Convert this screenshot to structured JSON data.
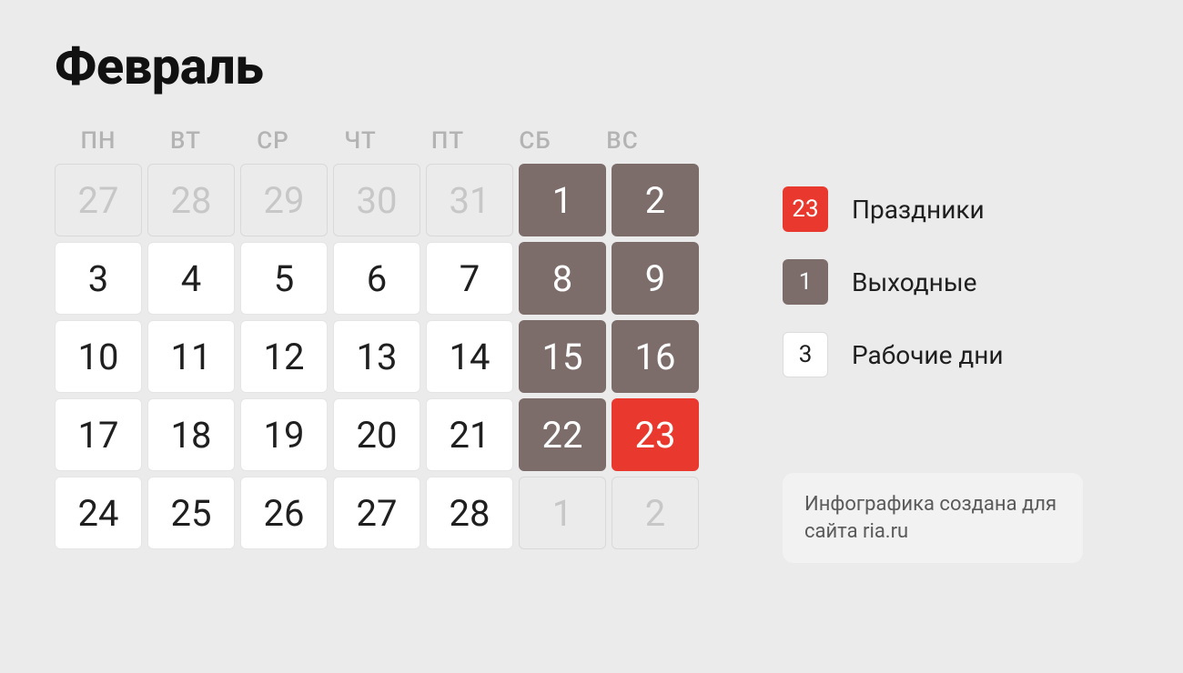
{
  "title": "Февраль",
  "weekdays": [
    "ПН",
    "ВТ",
    "СР",
    "ЧТ",
    "ПТ",
    "СБ",
    "ВС"
  ],
  "days": [
    {
      "n": "27",
      "type": "outside"
    },
    {
      "n": "28",
      "type": "outside"
    },
    {
      "n": "29",
      "type": "outside"
    },
    {
      "n": "30",
      "type": "outside"
    },
    {
      "n": "31",
      "type": "outside"
    },
    {
      "n": "1",
      "type": "weekend"
    },
    {
      "n": "2",
      "type": "weekend"
    },
    {
      "n": "3",
      "type": "work"
    },
    {
      "n": "4",
      "type": "work"
    },
    {
      "n": "5",
      "type": "work"
    },
    {
      "n": "6",
      "type": "work"
    },
    {
      "n": "7",
      "type": "work"
    },
    {
      "n": "8",
      "type": "weekend"
    },
    {
      "n": "9",
      "type": "weekend"
    },
    {
      "n": "10",
      "type": "work"
    },
    {
      "n": "11",
      "type": "work"
    },
    {
      "n": "12",
      "type": "work"
    },
    {
      "n": "13",
      "type": "work"
    },
    {
      "n": "14",
      "type": "work"
    },
    {
      "n": "15",
      "type": "weekend"
    },
    {
      "n": "16",
      "type": "weekend"
    },
    {
      "n": "17",
      "type": "work"
    },
    {
      "n": "18",
      "type": "work"
    },
    {
      "n": "19",
      "type": "work"
    },
    {
      "n": "20",
      "type": "work"
    },
    {
      "n": "21",
      "type": "work"
    },
    {
      "n": "22",
      "type": "weekend"
    },
    {
      "n": "23",
      "type": "holiday"
    },
    {
      "n": "24",
      "type": "work"
    },
    {
      "n": "25",
      "type": "work"
    },
    {
      "n": "26",
      "type": "work"
    },
    {
      "n": "27",
      "type": "work"
    },
    {
      "n": "28",
      "type": "work"
    },
    {
      "n": "1",
      "type": "outside"
    },
    {
      "n": "2",
      "type": "outside"
    }
  ],
  "legend": {
    "holiday": {
      "sample": "23",
      "label": "Праздники"
    },
    "weekend": {
      "sample": "1",
      "label": "Выходные"
    },
    "work": {
      "sample": "3",
      "label": "Рабочие дни"
    }
  },
  "credit": "Инфографика создана для сайта ria.ru"
}
